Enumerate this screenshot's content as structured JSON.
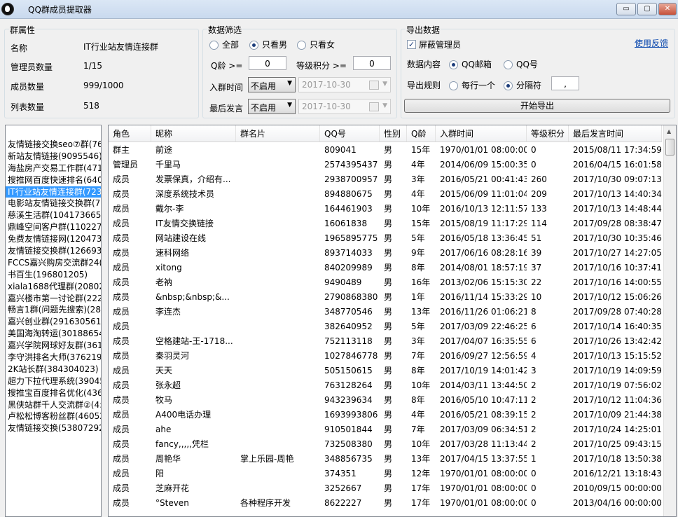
{
  "window": {
    "title": "QQ群成员提取器",
    "min": "▭",
    "max": "▢",
    "close": "✕"
  },
  "group_props": {
    "title": "群属性",
    "rows": [
      {
        "label": "名称",
        "value": "IT行业站友情连接群"
      },
      {
        "label": "管理员数量",
        "value": "1/15"
      },
      {
        "label": "成员数量",
        "value": "999/1000"
      },
      {
        "label": "列表数量",
        "value": "518"
      }
    ]
  },
  "filter": {
    "title": "数据筛选",
    "gender_all": "全部",
    "gender_male": "只看男",
    "gender_female": "只看女",
    "gender_selected": "只看男",
    "qage_label": "Q龄 >=",
    "qage_value": "0",
    "level_label": "等级积分 >=",
    "level_value": "0",
    "join_label": "入群时间",
    "join_mode": "不启用",
    "join_date": "2017-10-30",
    "last_label": "最后发言",
    "last_mode": "不启用",
    "last_date": "2017-10-30"
  },
  "export": {
    "title": "导出数据",
    "hide_admin": "屏蔽管理员",
    "hide_admin_checked": true,
    "content_label": "数据内容",
    "opt_email": "QQ邮箱",
    "opt_qq": "QQ号",
    "content_selected": "QQ邮箱",
    "rule_label": "导出规则",
    "opt_line": "每行一个",
    "opt_sep": "分隔符",
    "rule_selected": "分隔符",
    "separator": ",",
    "start_button": "开始导出",
    "feedback_link": "使用反馈"
  },
  "group_list": [
    "友情链接交换seo⑦群(76",
    "新站友情链接(9095546)",
    "海盐房产交易工作群(471",
    "搜推网百度快速排名(640",
    "IT行业站友情连接群(723",
    "电影站友情链接交换群(7:",
    "慈溪生活群(104173665)",
    "鼎峰空间客户群(1102276",
    "免费友情链接网(1204733",
    "友情链接交换群(126693:",
    "FCCS嘉兴购房交流群24(",
    "书百生(196801205)",
    "xiala1688代理群(208021",
    "嘉兴楼市第一讨论群(222",
    "畅言1群(问题先搜索)(286",
    "嘉兴创业群(291630561)",
    "美国海淘转运(30188654",
    "嘉兴学院网球好友群(361",
    "李守洪排名大师(3762193",
    "2K站长群(384304023)",
    "超力下拉代理系统(39045",
    "搜推宝百度排名优化(436",
    "黑侠站群千人交流群②(4:",
    "卢松松博客粉丝群(46052",
    "友情链接交换(53807292"
  ],
  "group_list_selected": 4,
  "table": {
    "columns": [
      "角色",
      "昵称",
      "群名片",
      "QQ号",
      "性别",
      "Q龄",
      "入群时间",
      "等级积分",
      "最后发言时间"
    ],
    "rows": [
      [
        "群主",
        "前途",
        "",
        "809041",
        "男",
        "15年",
        "1970/01/01 08:00:00",
        "0",
        "2015/08/11 17:34:59"
      ],
      [
        "管理员",
        "千里马",
        "",
        "2574395437",
        "男",
        "4年",
        "2014/06/09 15:00:35",
        "0",
        "2016/04/15 16:01:58"
      ],
      [
        "成员",
        "发票保真，介绍有...",
        "",
        "2938700957",
        "男",
        "3年",
        "2016/05/21 00:41:43",
        "260",
        "2017/10/30 09:07:13"
      ],
      [
        "成员",
        "深度系统技术员",
        "",
        "894880675",
        "男",
        "4年",
        "2015/06/09 11:01:04",
        "209",
        "2017/10/13 14:40:34"
      ],
      [
        "成员",
        "戴尔-李",
        "",
        "164461903",
        "男",
        "10年",
        "2016/10/13 12:11:57",
        "133",
        "2017/10/13 14:48:44"
      ],
      [
        "成员",
        "IT友情交换链接",
        "",
        "16061838",
        "男",
        "15年",
        "2015/08/19 11:17:29",
        "114",
        "2017/09/28 08:38:47"
      ],
      [
        "成员",
        "网站建设在线",
        "",
        "1965895775",
        "男",
        "5年",
        "2016/05/18 13:36:45",
        "51",
        "2017/10/30 10:35:46"
      ],
      [
        "成员",
        "速科网络",
        "",
        "893714033",
        "男",
        "9年",
        "2017/06/16 08:28:16",
        "39",
        "2017/10/27 14:27:05"
      ],
      [
        "成员",
        "xitong",
        "",
        "840209989",
        "男",
        "8年",
        "2014/08/01 18:57:19",
        "37",
        "2017/10/16 10:37:41"
      ],
      [
        "成员",
        "老衲",
        "",
        "9490489",
        "男",
        "16年",
        "2013/02/06 15:15:30",
        "22",
        "2017/10/16 14:00:55"
      ],
      [
        "成员",
        "&nbsp;&nbsp;&...",
        "",
        "2790868380",
        "男",
        "1年",
        "2016/11/14 15:33:29",
        "10",
        "2017/10/12 15:06:26"
      ],
      [
        "成员",
        "李连杰",
        "",
        "348770546",
        "男",
        "13年",
        "2016/11/26 01:06:21",
        "8",
        "2017/09/28 07:40:28"
      ],
      [
        "成员",
        "",
        "",
        "382640952",
        "男",
        "5年",
        "2017/03/09 22:46:25",
        "6",
        "2017/10/14 16:40:35"
      ],
      [
        "成员",
        "空格建站-王-1718...",
        "",
        "752113118",
        "男",
        "3年",
        "2017/04/07 16:35:55",
        "6",
        "2017/10/26 13:42:42"
      ],
      [
        "成员",
        "秦羽灵河",
        "",
        "1027846778",
        "男",
        "7年",
        "2016/09/27 12:56:59",
        "4",
        "2017/10/13 15:15:52"
      ],
      [
        "成员",
        "天天",
        "",
        "505150615",
        "男",
        "8年",
        "2017/10/19 14:01:42",
        "3",
        "2017/10/19 14:09:59"
      ],
      [
        "成员",
        "张永超",
        "",
        "763128264",
        "男",
        "10年",
        "2014/03/11 13:44:50",
        "2",
        "2017/10/19 07:56:02"
      ],
      [
        "成员",
        "牧马",
        "",
        "943239634",
        "男",
        "8年",
        "2016/05/10 10:47:11",
        "2",
        "2017/10/12 11:04:36"
      ],
      [
        "成员",
        "A400电话办理",
        "",
        "1693993806",
        "男",
        "4年",
        "2016/05/21 08:39:15",
        "2",
        "2017/10/09 21:44:38"
      ],
      [
        "成员",
        "ahe",
        "",
        "910501844",
        "男",
        "7年",
        "2017/03/09 06:34:51",
        "2",
        "2017/10/24 14:25:01"
      ],
      [
        "成员",
        "fancy,,,,,凭栏",
        "",
        "732508380",
        "男",
        "10年",
        "2017/03/28 11:13:44",
        "2",
        "2017/10/25 09:43:15"
      ],
      [
        "成员",
        "周艳华",
        "掌上乐园-周艳",
        "348856735",
        "男",
        "13年",
        "2017/04/15 13:37:55",
        "1",
        "2017/10/18 13:50:38"
      ],
      [
        "成员",
        "阳",
        "",
        "374351",
        "男",
        "12年",
        "1970/01/01 08:00:00",
        "0",
        "2016/12/21 13:18:43"
      ],
      [
        "成员",
        "芝麻开花",
        "",
        "3252667",
        "男",
        "17年",
        "1970/01/01 08:00:00",
        "0",
        "2010/09/15 00:00:00"
      ],
      [
        "成员",
        "°Steven",
        "各种程序开发",
        "8622227",
        "男",
        "17年",
        "1970/01/01 08:00:00",
        "0",
        "2013/04/16 00:00:00"
      ]
    ]
  }
}
